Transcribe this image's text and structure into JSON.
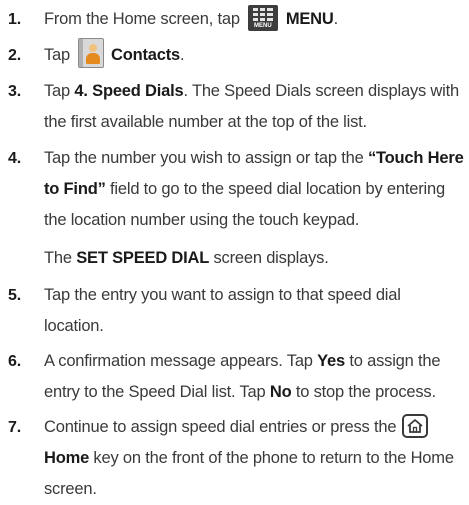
{
  "steps": [
    {
      "num": "1.",
      "pre": "From the Home screen, tap",
      "icon": "menu-grid-icon",
      "icon_label": "MENU",
      "bold": "MENU",
      "post": "."
    },
    {
      "num": "2.",
      "pre": "Tap",
      "icon": "contacts-icon",
      "bold": "Contacts",
      "post": "."
    },
    {
      "num": "3.",
      "pre": "Tap ",
      "bold": "4. Speed Dials",
      "post": ". The Speed Dials screen displays with",
      "line2": "the first available number at the top of the list."
    },
    {
      "num": "4.",
      "pre": "Tap the number you wish to assign or tap the ",
      "bold": "“Touch Here",
      "bold2": "to Find”",
      "post2": " field to go to the speed dial location by entering",
      "line3": "the location number using the touch keypad.",
      "note_pre": "The ",
      "note_bold": "SET SPEED DIAL",
      "note_post": " screen displays."
    },
    {
      "num": "5.",
      "line1": "Tap the entry you want to assign to that speed dial",
      "line2": "location."
    },
    {
      "num": "6.",
      "line1": "A confirmation message appears. Tap ",
      "bold_yes": "Yes",
      "mid": " to assign the",
      "line2_pre": "entry to the Speed Dial list. Tap ",
      "bold_no": "No",
      "line2_post": " to stop the process."
    },
    {
      "num": "7.",
      "line1": "Continue to assign speed dial entries or press the",
      "icon": "home-key-icon",
      "bold": "Home",
      "line2_post": " key on the front of the phone to return to the Home",
      "line3": "screen."
    }
  ]
}
